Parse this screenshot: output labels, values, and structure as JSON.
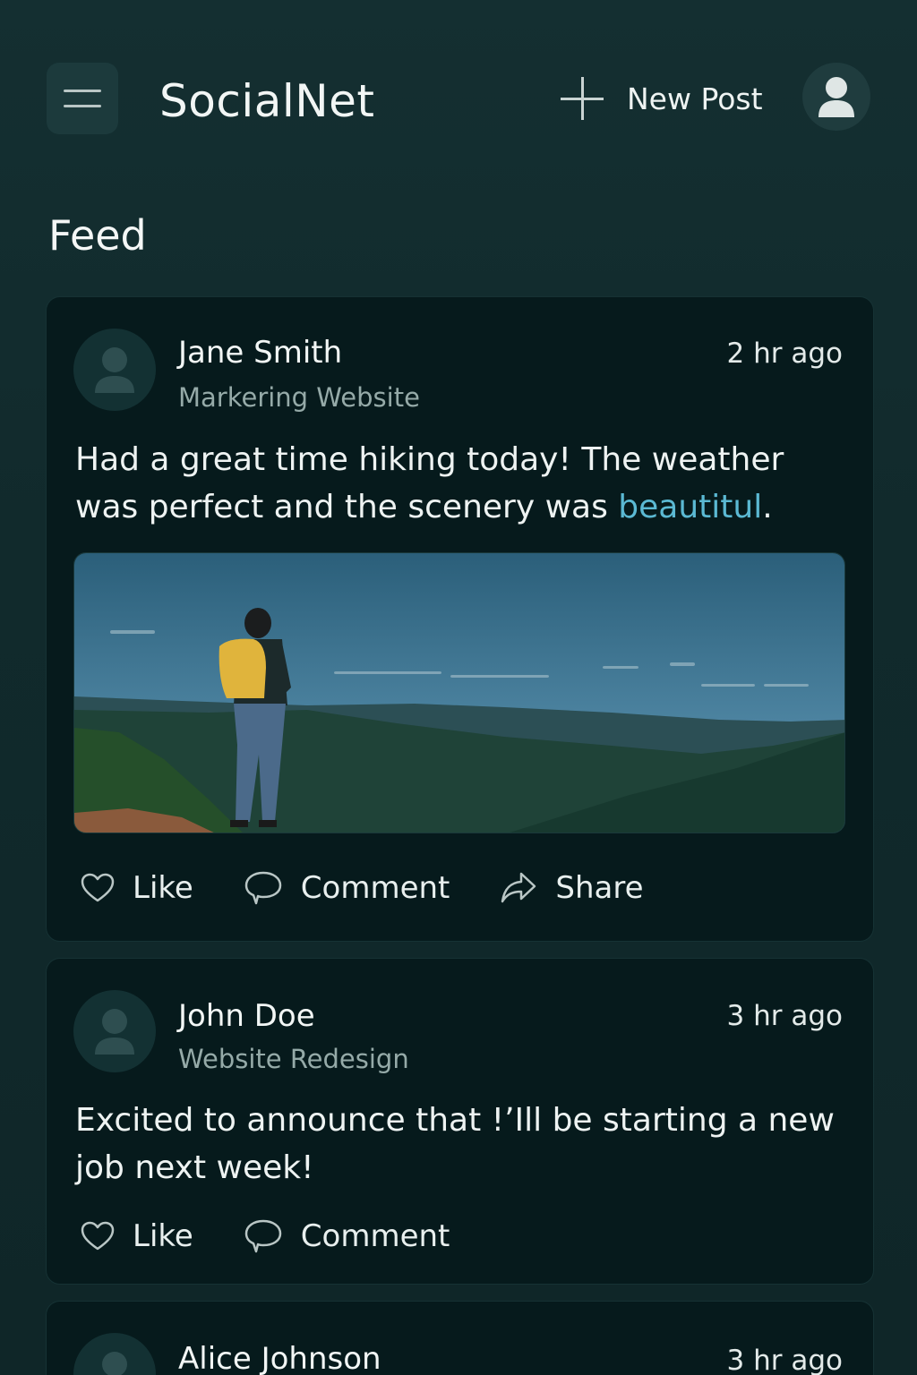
{
  "app": {
    "title": "SocialNet",
    "new_post_label": "New Post"
  },
  "feed": {
    "title": "Feed"
  },
  "posts": [
    {
      "author": "Jane Smith",
      "subtitle": "Markering Website",
      "time": "2 hr ago",
      "text_before_link": "Had a great time hiking today! The weather was perfect and the scenery was ",
      "link_text": "beautitul",
      "text_after_link": ".",
      "like_label": "Like",
      "comment_label": "Comment",
      "share_label": "Share"
    },
    {
      "author": "John Doe",
      "subtitle": "Website Redesign",
      "time": "3 hr ago",
      "text": "Excited to announce that !’Ill be starting a new job next week!",
      "like_label": "Like",
      "comment_label": "Comment"
    },
    {
      "author": "Alice Johnson",
      "time": "3 hr ago"
    }
  ],
  "colors": {
    "background": "#112a2c",
    "card": "#061a1c",
    "link": "#5bb9d3",
    "muted_text": "#95aaa8"
  },
  "icons": [
    "menu-icon",
    "plus-icon",
    "user-icon",
    "heart-icon",
    "comment-icon",
    "share-icon"
  ]
}
